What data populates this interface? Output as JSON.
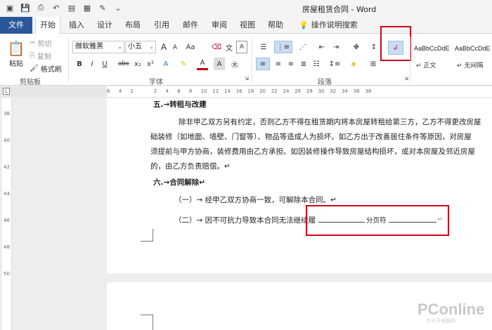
{
  "window": {
    "title": "房屋租赁合同 - Word"
  },
  "quick_access": [
    "save-icon",
    "print-preview-icon",
    "undo-icon",
    "picture-icon",
    "table-icon",
    "draw-icon",
    "customize-icon"
  ],
  "tabs": [
    {
      "label": "文件"
    },
    {
      "label": "开始"
    },
    {
      "label": "插入"
    },
    {
      "label": "设计"
    },
    {
      "label": "布局"
    },
    {
      "label": "引用"
    },
    {
      "label": "邮件"
    },
    {
      "label": "审阅"
    },
    {
      "label": "视图"
    },
    {
      "label": "帮助"
    }
  ],
  "tell_me": "操作说明搜索",
  "clipboard": {
    "paste": "粘贴",
    "cut": "剪切",
    "copy": "复制",
    "format_painter": "格式刷",
    "group": "剪贴板"
  },
  "font": {
    "name": "微软雅黑",
    "size": "小五",
    "group": "字体",
    "buttons": [
      "B",
      "I",
      "U",
      "abc",
      "x₂",
      "x²"
    ],
    "grow": "A",
    "shrink": "A",
    "case": "Aa",
    "change_case_color": "#c00000"
  },
  "paragraph": {
    "group": "段落"
  },
  "styles": [
    {
      "sample": "AaBbCcDdE",
      "name": "↵ 正文"
    },
    {
      "sample": "AaBbCcDdE",
      "name": "↵ 无间隔"
    }
  ],
  "ruler": {
    "h_numbers": [
      "6",
      "4",
      "2",
      "",
      "2",
      "4",
      "6",
      "8",
      "10",
      "12",
      "14",
      "16",
      "18",
      "20",
      "22",
      "24",
      "26",
      "28",
      "30",
      "32",
      "34",
      "36",
      "38"
    ],
    "v_numbers": [
      "38",
      "40",
      "42",
      "44",
      "46",
      "48",
      "50"
    ]
  },
  "document": {
    "partial_heading": "五.→转租与改建",
    "para1_line1": "除非甲乙双方另有约定，否则乙方不得在租赁期内将本房屋转租给第三方，乙方不得更改房屋",
    "para1_line2": "础装修（如地面、墙壁、门窗等）、物品等造成人为损坏。如乙方出于改善居住条件等原因，对房屋",
    "para1_line3": "须提前与甲方协商，装修费用由乙方承担。如因装修操作导致房屋结构损坏，或对本房屋及邻近房屋",
    "para1_line4": "的，由乙方负责赔偿。↵",
    "heading6": "六.→合同解除↵",
    "item1": "（一）→ 经甲乙双方协商一致，可解除本合同。↵",
    "item2": "（二）→ 因不可抗力导致本合同无法继续履",
    "page_break_label": "分页符",
    "page_break_mark": "↵"
  },
  "watermark": {
    "main": "PConline",
    "sub": "太平洋电脑网"
  }
}
